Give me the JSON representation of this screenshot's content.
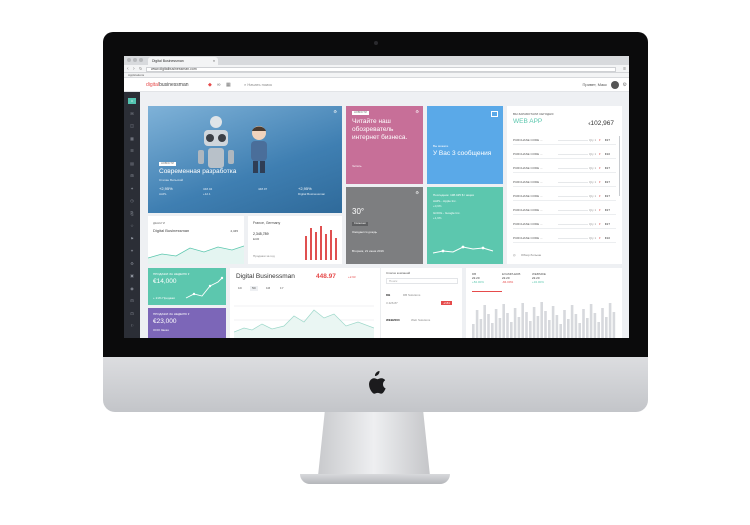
{
  "browser": {
    "tab_title": "Digital Businessman",
    "tab_close": "×",
    "url": "www.digitalbusinessman.com",
    "bookmarks_label": "Applications",
    "nav_back": "‹",
    "nav_forward": "›",
    "reload": "↻",
    "menu": "≡"
  },
  "app": {
    "logo_prefix": "digital",
    "logo_suffix": "businessman",
    "search_placeholder": "Начать поиск",
    "greeting": "Привет, Макс",
    "search_glyph": "⌕",
    "settings_glyph": "⚙",
    "accent_color": "#e64b4b"
  },
  "sidebar": {
    "icons": [
      "⌂",
      "✉",
      "◫",
      "▦",
      "☰",
      "▤",
      "⊞",
      "✦",
      "◷",
      "⎘",
      "☆",
      "⚑",
      "⌖",
      "⚙",
      "▣",
      "◉",
      "⊟",
      "⊡",
      "⚐"
    ]
  },
  "hero": {
    "badge": "НОВОСТИ",
    "title": "Современная разработка",
    "author": "Степан Вильский",
    "aapl_label": "AAPL",
    "aapl_value": "+2,95%",
    "aapl_price": "348.04",
    "aapl_extra": "+12.1",
    "db_value": "+2,95%",
    "db_label": "Digital Businessman",
    "db_price": "448.97"
  },
  "news": {
    "badge": "НОВОСТИ",
    "text": "Читайте наш обозреватель интернет бизнеса.",
    "link": "Читать"
  },
  "messages": {
    "label": "Вы можете",
    "text": "У Вас 3 сообщения"
  },
  "weather": {
    "temp": "30°",
    "badge": "Солнечно",
    "forecast": "Ожидается дождь",
    "date": "Вторник, 21 июня 2016"
  },
  "stocks": {
    "header": "Последние: 138.425 $ / акция",
    "line1": "AAPL - Apple Inc.",
    "line1_change": "+0,6%",
    "line2": "GOOG - Google Inc.",
    "line2_change": "+1,6%"
  },
  "sales": {
    "label": "ВЫ ЗАРАБОТАЛИ СЕГОДНЯ",
    "title": "WEB APP",
    "currency": "€",
    "amount": "102,967",
    "rows": [
      {
        "name": "PURCHASE CODE ...",
        "qty": "Qty 1",
        "price": "€27"
      },
      {
        "name": "PURCHASE CODE ...",
        "qty": "Qty 1",
        "price": "€10"
      },
      {
        "name": "PURCHASE CODE ...",
        "qty": "Qty 1",
        "price": "€27"
      },
      {
        "name": "PURCHASE CODE ...",
        "qty": "Qty 1",
        "price": "€27"
      },
      {
        "name": "PURCHASE CODE ...",
        "qty": "Qty 1",
        "price": "€27"
      },
      {
        "name": "PURCHASE CODE ...",
        "qty": "Qty 1",
        "price": "€27"
      },
      {
        "name": "PURCHASE CODE ...",
        "qty": "Qty 1",
        "price": "€27"
      },
      {
        "name": "PURCHASE CODE ...",
        "qty": "Qty 1",
        "price": "€10"
      }
    ],
    "footer": "Обзор больше"
  },
  "deposit": {
    "label": "ДЕНЬГИ",
    "name": "Digital Businessman",
    "value": "2,345"
  },
  "region": {
    "name": "France, Germany",
    "value": "2,345,789",
    "currency": "EUR",
    "footer": "Продажи за год"
  },
  "widget1": {
    "label": "ПРОДАЖИ ЗА НЕДЕЛЮ ▾",
    "amount": "€14,000",
    "sub": "+ 21% Продажи"
  },
  "widget2": {
    "label": "ПРОДАЖИ ЗА НЕДЕЛЮ ▾",
    "amount": "€23,000",
    "sub": "ООО Заказ"
  },
  "stock_chart": {
    "title": "Digital Businessman",
    "price": "448.97",
    "change": "+2.63",
    "tabs": [
      "1D",
      "5D",
      "1M",
      "1Y"
    ],
    "list_title": "Список компаний",
    "list_search": "Поиск",
    "item1": "DB",
    "item1_name": "DB Solutions",
    "item1_price": "3 426.87",
    "item1_change": "-2.84",
    "item2": "WEB2000",
    "item2_name": "Web Solutions"
  },
  "bars": {
    "tabs": [
      {
        "label": "DB",
        "value": "22.20",
        "change": "+84.00%"
      },
      {
        "label": "EXAMPLEDB",
        "value": "22.20",
        "change": "-84.00%"
      },
      {
        "label": "WEBSIDE",
        "value": "22.20",
        "change": "+34.00%"
      }
    ]
  }
}
